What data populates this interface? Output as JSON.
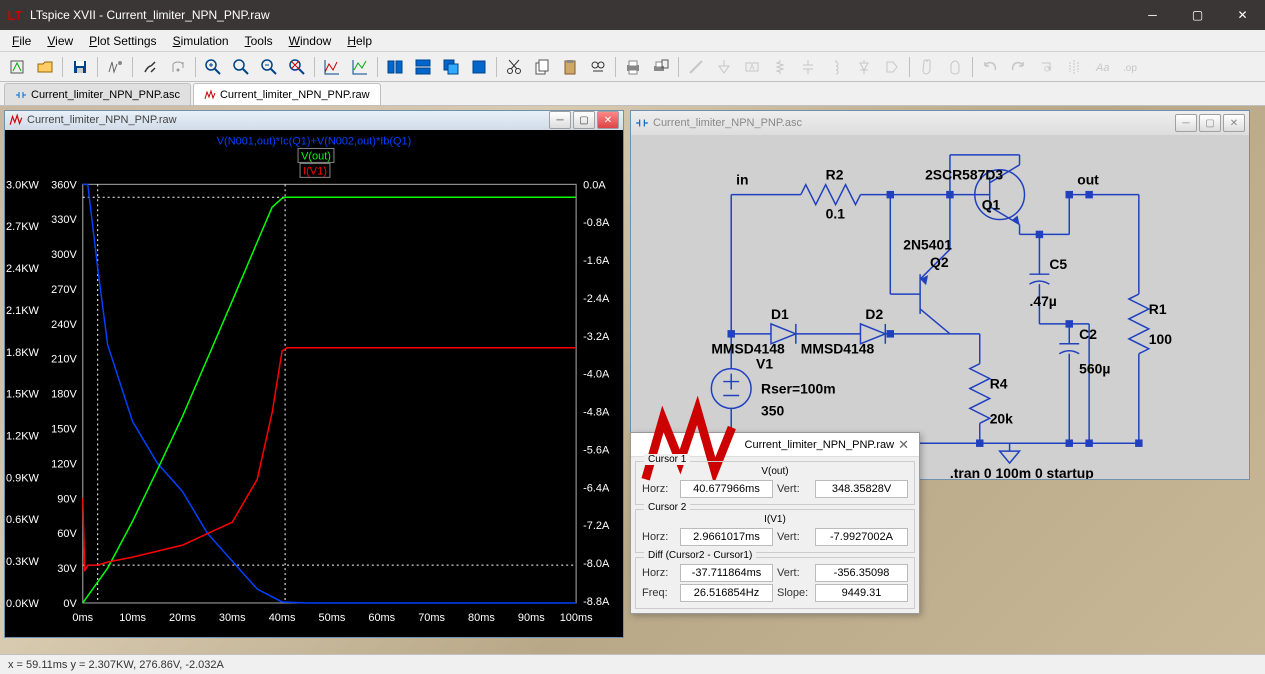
{
  "app": {
    "title": "LTspice XVII - Current_limiter_NPN_PNP.raw"
  },
  "menu": [
    "File",
    "View",
    "Plot Settings",
    "Simulation",
    "Tools",
    "Window",
    "Help"
  ],
  "tabs": [
    {
      "label": "Current_limiter_NPN_PNP.asc",
      "active": false,
      "icon": "schematic"
    },
    {
      "label": "Current_limiter_NPN_PNP.raw",
      "active": true,
      "icon": "waveform"
    }
  ],
  "statusbar": {
    "text": "x = 59.11ms     y = 2.307KW, 276.86V, -2.032A"
  },
  "plot_window": {
    "title": "Current_limiter_NPN_PNP.raw"
  },
  "schematic_window": {
    "title": "Current_limiter_NPN_PNP.asc"
  },
  "cursor_dialog": {
    "title": "Current_limiter_NPN_PNP.raw",
    "cursor1": {
      "legend": "Cursor 1",
      "trace": "V(out)",
      "horz_lbl": "Horz:",
      "horz": "40.677966ms",
      "vert_lbl": "Vert:",
      "vert": "348.35828V"
    },
    "cursor2": {
      "legend": "Cursor 2",
      "trace": "I(V1)",
      "horz_lbl": "Horz:",
      "horz": "2.9661017ms",
      "vert_lbl": "Vert:",
      "vert": "-7.9927002A"
    },
    "diff": {
      "legend": "Diff (Cursor2 - Cursor1)",
      "horz_lbl": "Horz:",
      "horz": "-37.711864ms",
      "vert_lbl": "Vert:",
      "vert": "-356.35098",
      "freq_lbl": "Freq:",
      "freq": "26.516854Hz",
      "slope_lbl": "Slope:",
      "slope": "9449.31"
    }
  },
  "schematic": {
    "nets": {
      "in": "in",
      "out": "out"
    },
    "components": {
      "R2": {
        "name": "R2",
        "value": "0.1"
      },
      "Q1": {
        "name": "Q1",
        "model": "2SCR587D3"
      },
      "Q2": {
        "name": "Q2",
        "model": "2N5401"
      },
      "D1": {
        "name": "D1",
        "model": "MMSD4148"
      },
      "D2": {
        "name": "D2",
        "model": "MMSD4148"
      },
      "V1": {
        "name": "V1",
        "value": "350",
        "rser": "Rser=100m"
      },
      "R4": {
        "name": "R4",
        "value": "20k"
      },
      "C5": {
        "name": "C5",
        "value": ".47µ"
      },
      "C2": {
        "name": "C2",
        "value": "560µ"
      },
      "R1": {
        "name": "R1",
        "value": "100"
      }
    },
    "directive": ".tran 0 100m 0 startup"
  },
  "chart_data": {
    "type": "line",
    "x_axis": {
      "label": "",
      "unit": "ms",
      "min": 0,
      "max": 100,
      "ticks": [
        "0ms",
        "10ms",
        "20ms",
        "30ms",
        "40ms",
        "50ms",
        "60ms",
        "70ms",
        "80ms",
        "90ms",
        "100ms"
      ]
    },
    "y_axes": [
      {
        "side": "far-left",
        "unit": "KW",
        "min": 0,
        "max": 3.0,
        "ticks": [
          "0.0KW",
          "0.3KW",
          "0.6KW",
          "0.9KW",
          "1.2KW",
          "1.5KW",
          "1.8KW",
          "2.1KW",
          "2.4KW",
          "2.7KW",
          "3.0KW"
        ],
        "trace": "power"
      },
      {
        "side": "left",
        "unit": "V",
        "min": 0,
        "max": 360,
        "ticks": [
          "0V",
          "30V",
          "60V",
          "90V",
          "120V",
          "150V",
          "180V",
          "210V",
          "240V",
          "270V",
          "300V",
          "330V",
          "360V"
        ],
        "trace": "V(out)"
      },
      {
        "side": "right",
        "unit": "A",
        "min": -8.8,
        "max": 0.0,
        "ticks": [
          "0.0A",
          "-0.8A",
          "-1.6A",
          "-2.4A",
          "-3.2A",
          "-4.0A",
          "-4.8A",
          "-5.6A",
          "-6.4A",
          "-7.2A",
          "-8.0A",
          "-8.8A"
        ],
        "trace": "I(V1)"
      }
    ],
    "series": [
      {
        "name": "V(N001,out)*Ic(Q1)+V(N002,out)*Ib(Q1)",
        "color": "#0040ff",
        "axis": "far-left",
        "x": [
          0,
          1,
          3,
          5,
          10,
          15,
          20,
          25,
          30,
          35,
          40,
          45,
          100
        ],
        "y": [
          3.0,
          3.0,
          2.4,
          1.85,
          1.3,
          1.0,
          0.8,
          0.5,
          0.3,
          0.1,
          0.01,
          0,
          0
        ]
      },
      {
        "name": "V(out)",
        "color": "#00ff00",
        "axis": "left",
        "x": [
          0,
          5,
          10,
          15,
          20,
          25,
          30,
          35,
          38,
          40,
          40.7,
          100
        ],
        "y": [
          0,
          30,
          70,
          115,
          160,
          210,
          260,
          310,
          340,
          348,
          348.4,
          348.4
        ]
      },
      {
        "name": "I(V1)",
        "color": "#ff0000",
        "axis": "right",
        "x": [
          0,
          0.5,
          1,
          3,
          5,
          10,
          20,
          30,
          35,
          38,
          40,
          41,
          100
        ],
        "y": [
          -6.6,
          -8.1,
          -8.0,
          -8.0,
          -7.95,
          -7.85,
          -7.6,
          -7.1,
          -6.2,
          -4.8,
          -3.5,
          -3.45,
          -3.45
        ]
      }
    ],
    "cursors": [
      {
        "id": 1,
        "x_ms": 40.678,
        "dashed": true
      },
      {
        "id": 2,
        "x_ms": 2.966,
        "dashed": true
      }
    ]
  }
}
